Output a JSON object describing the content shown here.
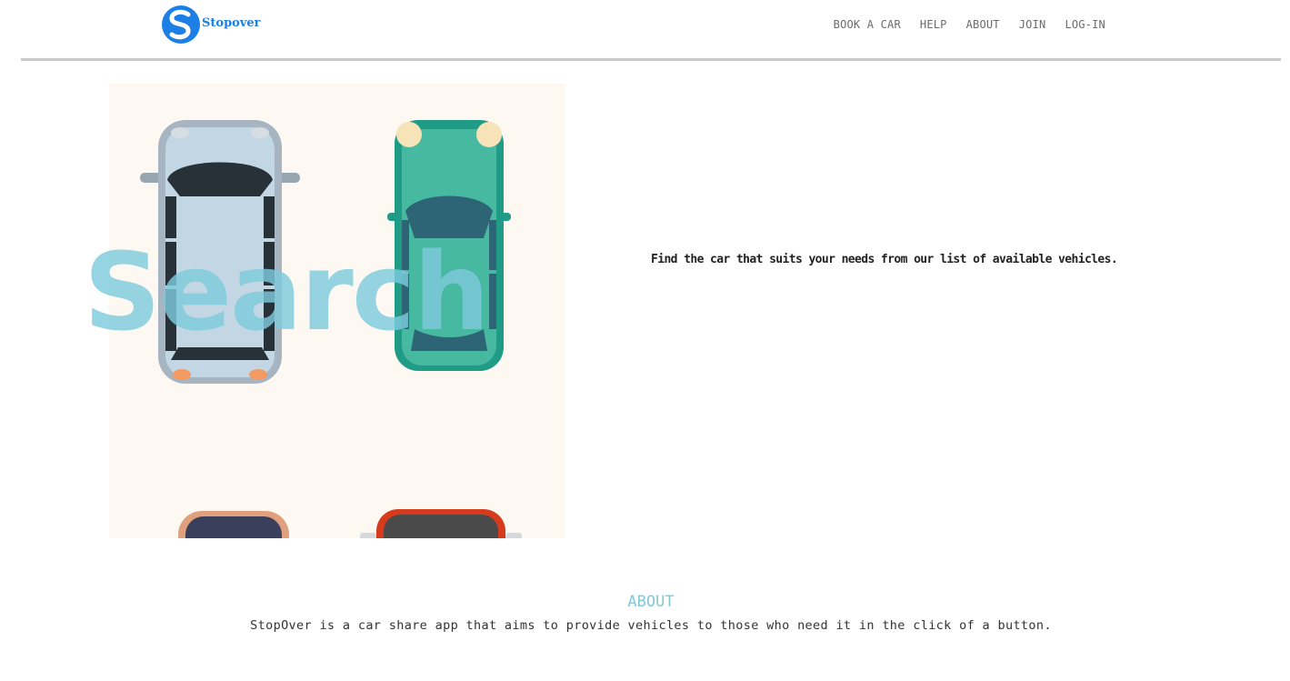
{
  "header": {
    "logo_text": "Stopover",
    "nav": {
      "book_a_car": "BOOK A CAR",
      "help": "HELP",
      "about": "ABOUT",
      "join": "JOIN",
      "log_in": "LOG-IN"
    }
  },
  "hero": {
    "search_label": "Search",
    "tagline": "Find the car that suits your needs from our list of available vehicles."
  },
  "about": {
    "title": "ABOUT",
    "body": "StopOver is a car share app that aims to provide vehicles to those who need it in the click of a button."
  },
  "colors": {
    "brand_blue": "#1b7fe6",
    "accent_cyan": "#82c8d6",
    "divider": "#c9c9c9"
  }
}
